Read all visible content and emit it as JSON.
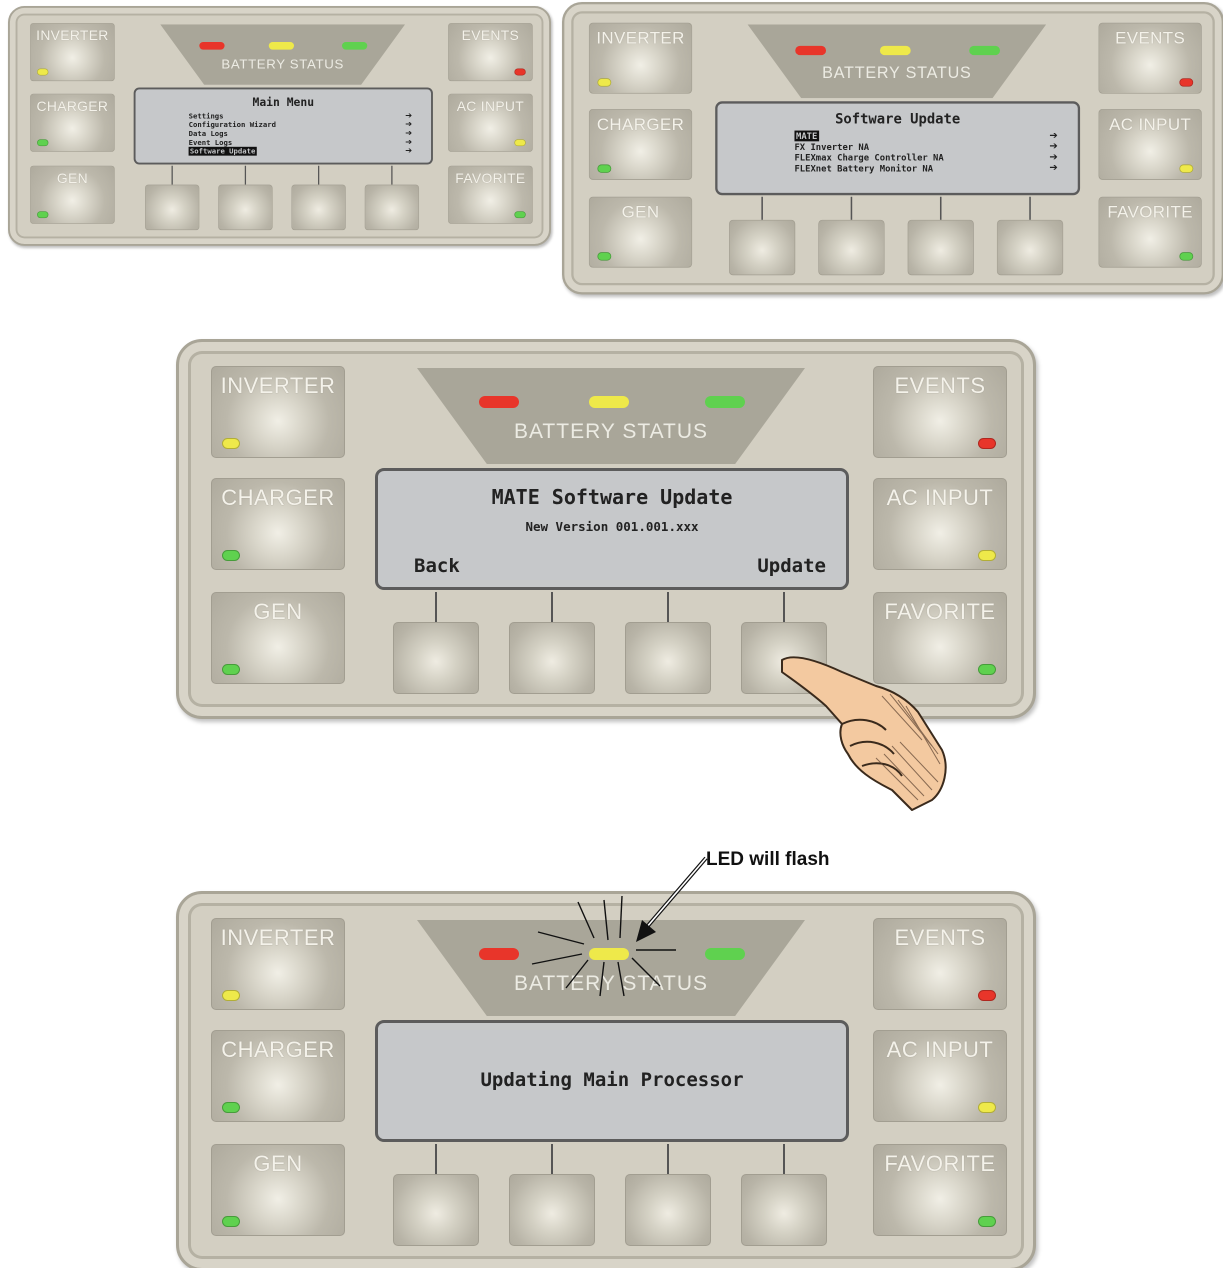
{
  "panel_labels": {
    "inverter": "INVERTER",
    "charger": "CHARGER",
    "gen": "GEN",
    "events": "EVENTS",
    "ac_input": "AC INPUT",
    "favorite": "FAVORITE",
    "battery_status": "BATTERY STATUS"
  },
  "screen1": {
    "title": "Main Menu",
    "items": [
      "Settings",
      "Configuration Wizard",
      "Data Logs",
      "Event Logs",
      "Software Update"
    ],
    "selected": "Software Update"
  },
  "screen2": {
    "title": "Software Update",
    "items": [
      "MATE",
      "FX Inverter NA",
      "FLEXmax Charge Controller NA",
      "FLEXnet Battery Monitor NA"
    ],
    "selected": "MATE"
  },
  "screen3": {
    "title": "MATE Software Update",
    "version": "New Version 001.001.xxx",
    "left_softkey": "Back",
    "right_softkey": "Update"
  },
  "screen4": {
    "status": "Updating Main Processor"
  },
  "annotation": {
    "led_flash": "LED will flash"
  },
  "colors": {
    "panel": "#d3cfc2",
    "lcd": "#c6c8ca",
    "led_red": "#e8352a",
    "led_yellow": "#eee94a",
    "led_green": "#5fd14f"
  }
}
